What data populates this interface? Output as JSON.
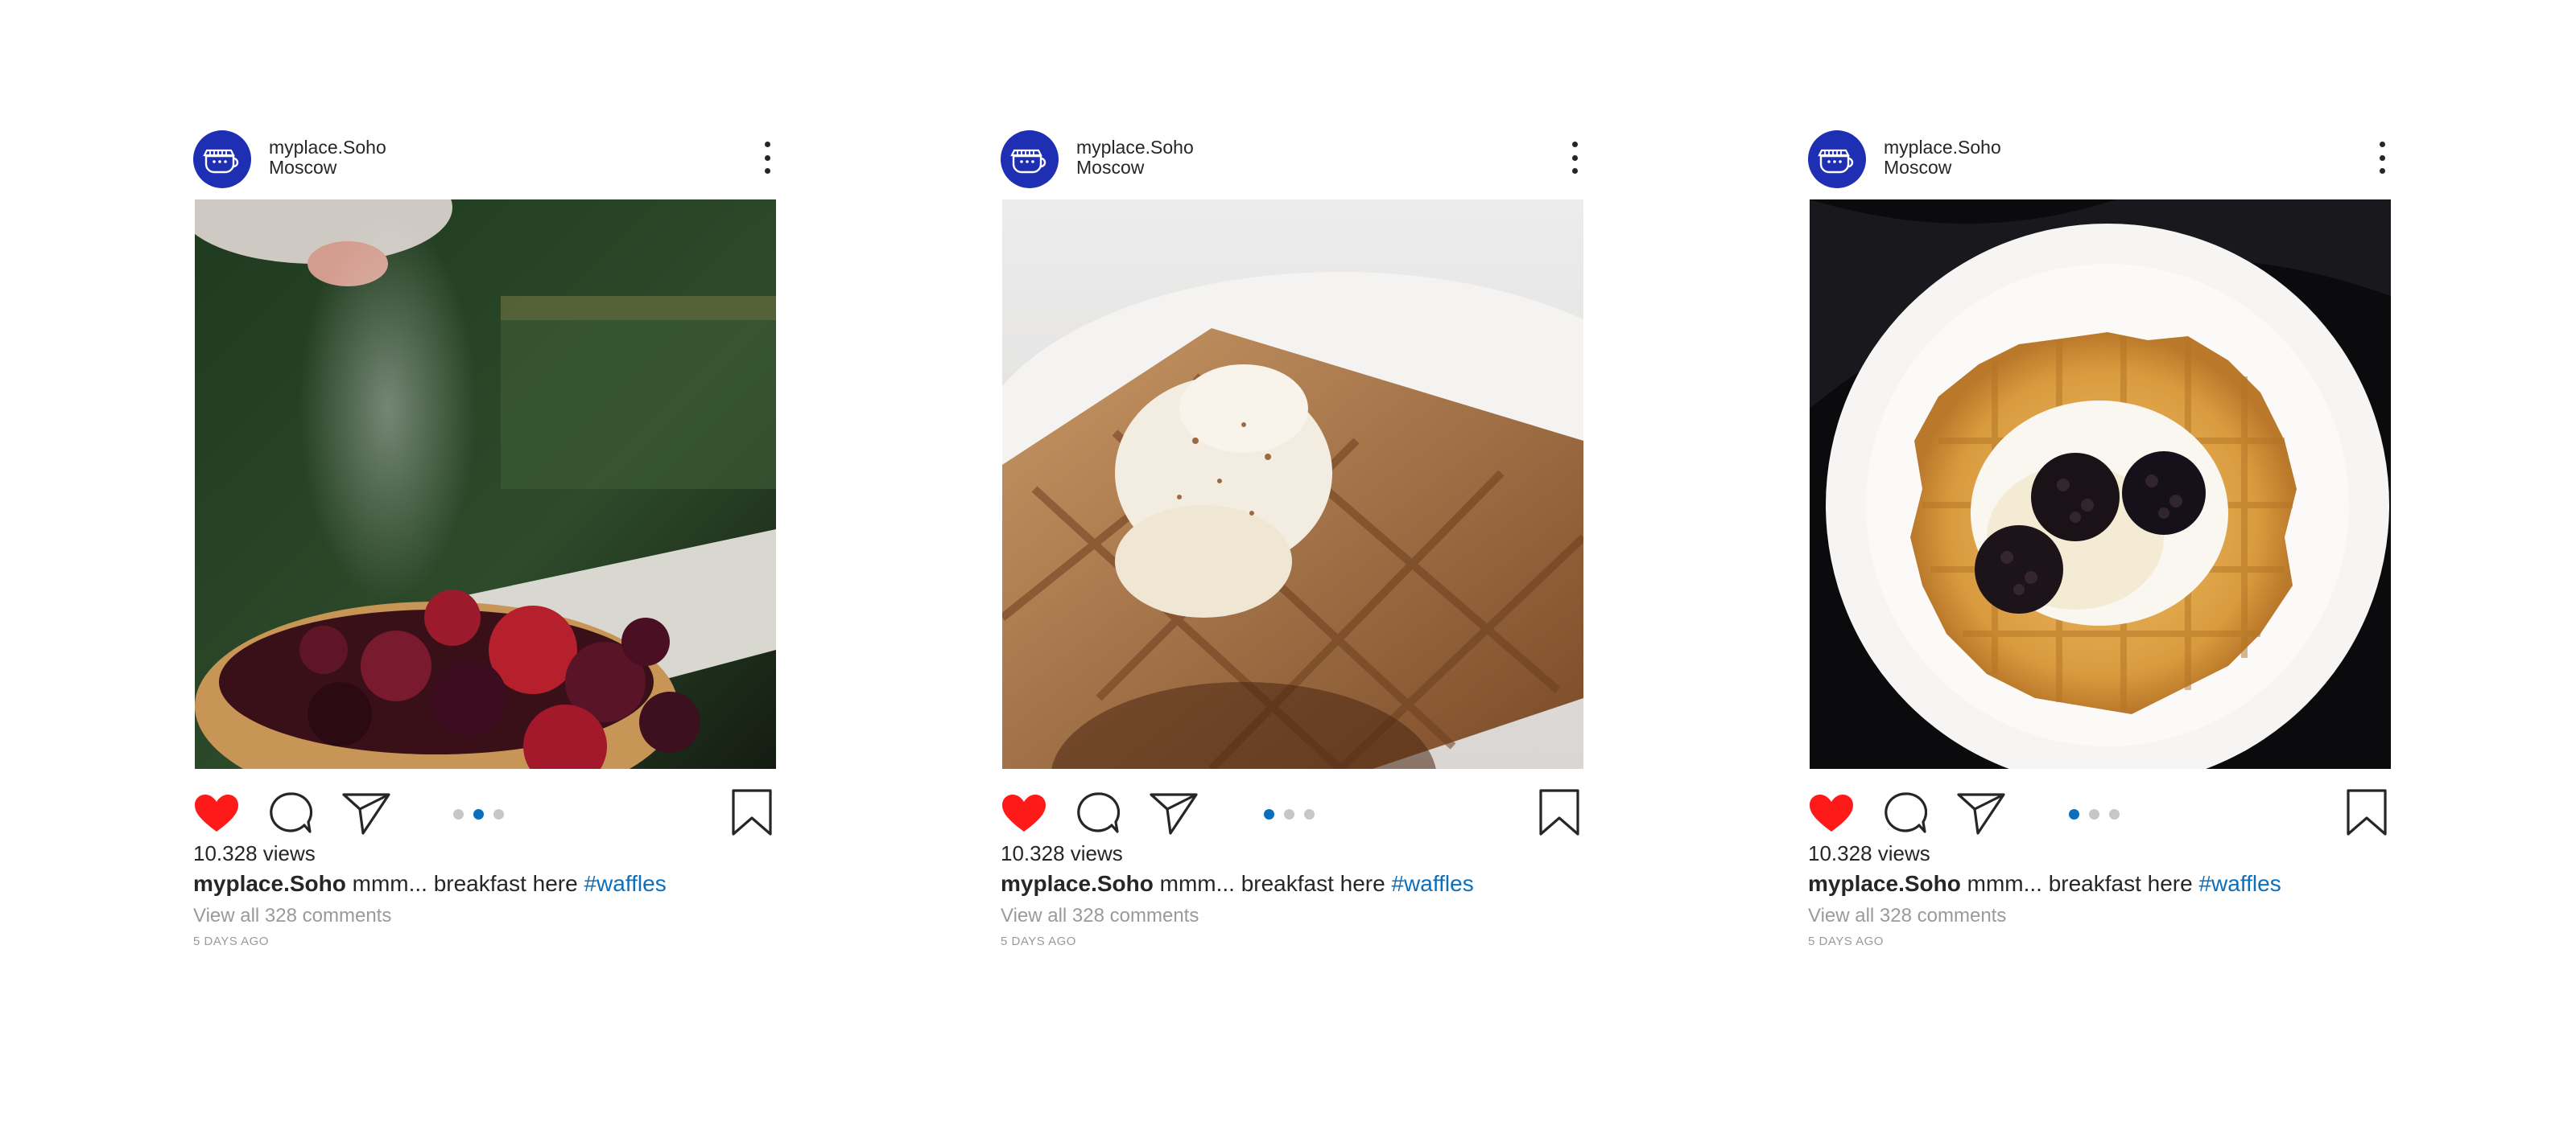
{
  "colors": {
    "like": "#ff1a1a",
    "link": "#0c6fbb",
    "avatar": "#1f2fb3",
    "muted": "#9a9a9a"
  },
  "posts": [
    {
      "username": "myplace.Soho",
      "location": "Moscow",
      "image": "waffle-with-berries-and-sugar-photo",
      "views": "10.328 views",
      "caption_user": "myplace.Soho",
      "caption_text": " mmm... breakfast here ",
      "hashtag": "#waffles",
      "comments_link": "View all 328 comments",
      "time": "5 DAYS AGO",
      "active_slide": 2,
      "slide_count": 3
    },
    {
      "username": "myplace.Soho",
      "location": "Moscow",
      "image": "waffle-with-ice-cream-photo",
      "views": "10.328 views",
      "caption_user": "myplace.Soho",
      "caption_text": " mmm... breakfast here ",
      "hashtag": "#waffles",
      "comments_link": "View all 328 comments",
      "time": "5 DAYS AGO",
      "active_slide": 1,
      "slide_count": 3
    },
    {
      "username": "myplace.Soho",
      "location": "Moscow",
      "image": "waffle-with-blackberries-photo",
      "views": "10.328 views",
      "caption_user": "myplace.Soho",
      "caption_text": " mmm... breakfast here ",
      "hashtag": "#waffles",
      "comments_link": "View all 328 comments",
      "time": "5 DAYS AGO",
      "active_slide": 1,
      "slide_count": 3
    }
  ],
  "icons": {
    "avatar": "cafe-logo-icon",
    "more": "more-vertical-icon",
    "like": "heart-icon",
    "comment": "comment-icon",
    "share": "send-icon",
    "save": "bookmark-icon"
  }
}
